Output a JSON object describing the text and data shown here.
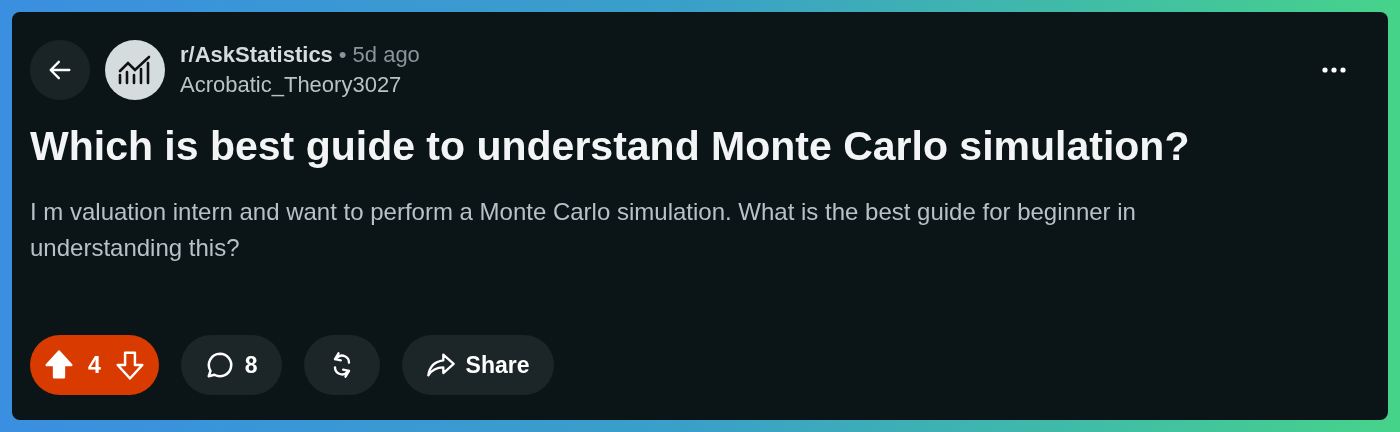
{
  "post": {
    "subreddit": "r/AskStatistics",
    "separator": "•",
    "age": "5d ago",
    "author": "Acrobatic_Theory3027",
    "title": "Which is best guide to understand Monte Carlo simulation?",
    "body": "I m valuation intern and want to perform a Monte Carlo simulation. What is the best guide for beginner in understanding this?"
  },
  "actions": {
    "vote": {
      "score": "4",
      "upvoted": true
    },
    "comments": "8",
    "share": "Share"
  }
}
